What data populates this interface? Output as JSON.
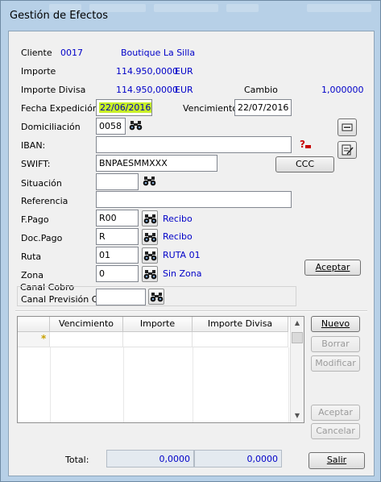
{
  "window": {
    "title": "Gestión de Efectos"
  },
  "header": {
    "cliente_label": "Cliente",
    "cliente_code": "0017",
    "cliente_name": "Boutique La Silla",
    "importe_label": "Importe",
    "importe_value": "114.950,0000",
    "importe_currency": "EUR",
    "importe_divisa_label": "Importe Divisa",
    "importe_divisa_value": "114.950,0000",
    "importe_divisa_currency": "EUR",
    "cambio_label": "Cambio",
    "cambio_value": "1,000000"
  },
  "form": {
    "fecha_expedicion_label": "Fecha Expedición",
    "fecha_expedicion_value": "22/06/2016",
    "vencimiento_label": "Vencimiento",
    "vencimiento_value": "22/07/2016",
    "domiciliacion_label": "Domiciliación",
    "domiciliacion_value": "0058",
    "iban_label": "IBAN:",
    "iban_value": "",
    "swift_label": "SWIFT:",
    "swift_value": "BNPAESMMXXX",
    "ccc_label": "CCC",
    "situacion_label": "Situación",
    "situacion_value": "",
    "referencia_label": "Referencia",
    "referencia_value": "",
    "fpago_label": "F.Pago",
    "fpago_value": "R00",
    "fpago_desc": "Recibo",
    "docpago_label": "Doc.Pago",
    "docpago_value": "R",
    "docpago_desc": "Recibo",
    "ruta_label": "Ruta",
    "ruta_value": "01",
    "ruta_desc": "RUTA 01",
    "zona_label": "Zona",
    "zona_value": "0",
    "zona_desc": "Sin Zona",
    "aceptar_label": "Aceptar",
    "canal_cobro_label": "Canal Cobro",
    "canal_prevision_label": "Canal Previsión Cob",
    "canal_prevision_value": ""
  },
  "grid": {
    "columns": [
      "Vencimiento",
      "Importe",
      "Importe Divisa"
    ],
    "new_row_marker": "*"
  },
  "side_buttons": {
    "nuevo": "Nuevo",
    "borrar": "Borrar",
    "modificar": "Modificar",
    "aceptar": "Aceptar",
    "cancelar": "Cancelar"
  },
  "footer": {
    "total_label": "Total:",
    "total_importe": "0,0000",
    "total_divisa": "0,0000",
    "salir_label": "Salir"
  },
  "colors": {
    "window_frame": "#b7d0e7",
    "value_text": "#0000c8",
    "highlight": "#c8f028"
  }
}
